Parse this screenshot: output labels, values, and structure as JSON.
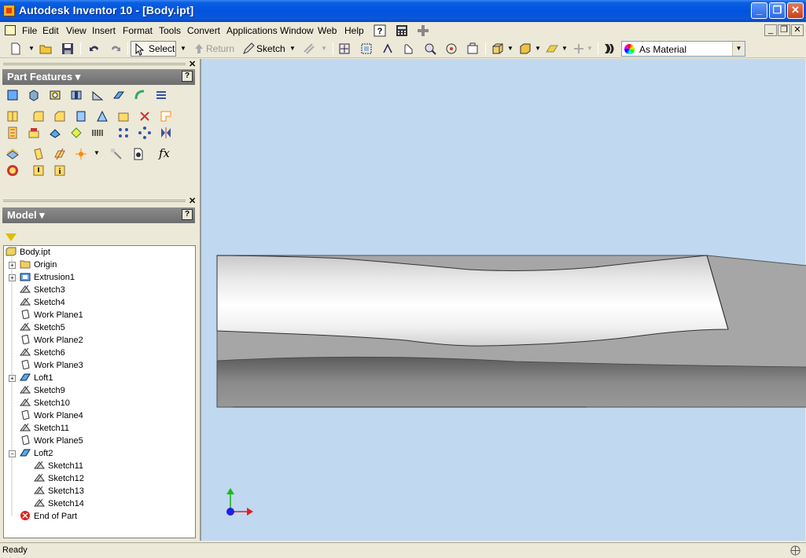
{
  "window": {
    "title": "Autodesk Inventor 10 - [Body.ipt]"
  },
  "menu": [
    "File",
    "Edit",
    "View",
    "Insert",
    "Format",
    "Tools",
    "Convert",
    "Applications",
    "Window",
    "Web",
    "Help"
  ],
  "toolbar": {
    "select_label": "Select",
    "return_label": "Return",
    "sketch_label": "Sketch",
    "appearance_value": "As Material"
  },
  "panels": {
    "features_title": "Part Features",
    "model_title": "Model",
    "help_glyph": "?"
  },
  "tree": {
    "root": "Body.ipt",
    "items": [
      {
        "label": "Origin",
        "icon": "folder-icon"
      },
      {
        "label": "Extrusion1",
        "icon": "extrusion-icon"
      },
      {
        "label": "Sketch3",
        "icon": "sketch-icon"
      },
      {
        "label": "Sketch4",
        "icon": "sketch-icon"
      },
      {
        "label": "Work Plane1",
        "icon": "work-plane-icon"
      },
      {
        "label": "Sketch5",
        "icon": "sketch-icon"
      },
      {
        "label": "Work Plane2",
        "icon": "work-plane-icon"
      },
      {
        "label": "Sketch6",
        "icon": "sketch-icon"
      },
      {
        "label": "Work Plane3",
        "icon": "work-plane-icon"
      },
      {
        "label": "Loft1",
        "icon": "loft-icon"
      },
      {
        "label": "Sketch9",
        "icon": "sketch-icon"
      },
      {
        "label": "Sketch10",
        "icon": "sketch-icon"
      },
      {
        "label": "Work Plane4",
        "icon": "work-plane-icon"
      },
      {
        "label": "Sketch11",
        "icon": "sketch-icon"
      },
      {
        "label": "Work Plane5",
        "icon": "work-plane-icon"
      },
      {
        "label": "Loft2",
        "icon": "loft-icon"
      }
    ],
    "loft2_children": [
      "Sketch11",
      "Sketch12",
      "Sketch13",
      "Sketch14"
    ],
    "end": "End of Part"
  },
  "status": {
    "text": "Ready"
  },
  "colors": {
    "viewport_bg": "#c0d8f0",
    "title_blue": "#0053e1"
  }
}
